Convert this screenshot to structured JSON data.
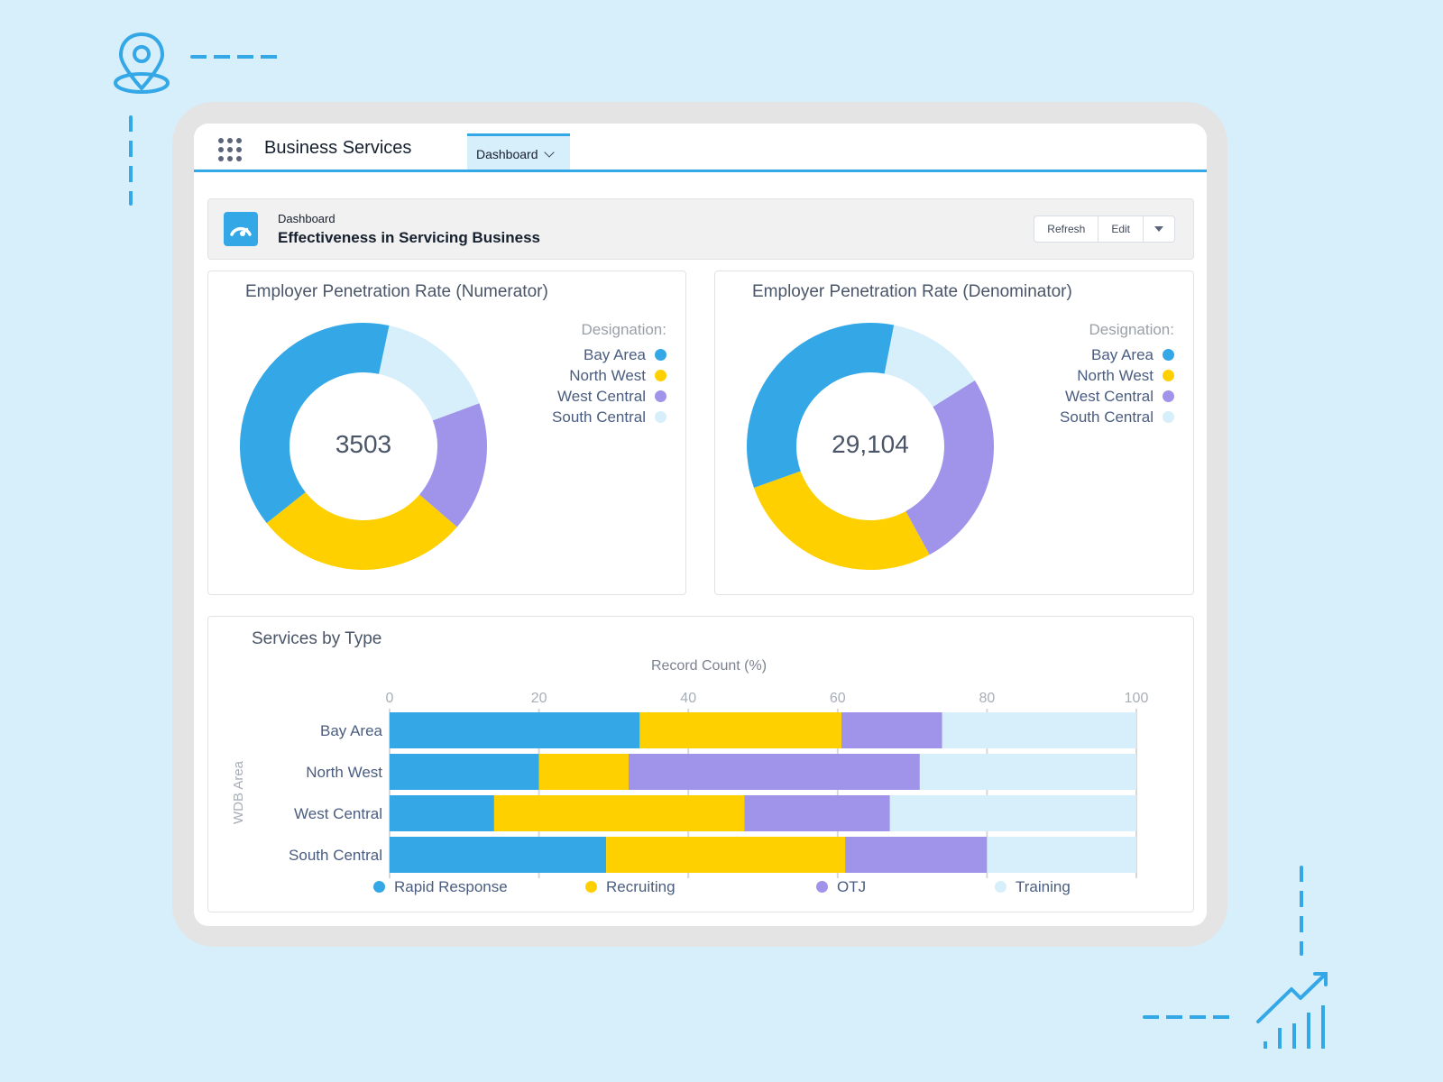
{
  "app": {
    "title": "Business Services",
    "nav_tab": "Dashboard"
  },
  "dashboard_header": {
    "label": "Dashboard",
    "title": "Effectiveness in Servicing Business",
    "buttons": {
      "refresh": "Refresh",
      "edit": "Edit"
    }
  },
  "colors": {
    "bay_area": "#34a8e6",
    "north_west": "#ffd000",
    "west_central": "#a094ea",
    "south_central": "#d7eefb",
    "accent": "#34a8e6"
  },
  "chart_data": [
    {
      "type": "pie",
      "variant": "donut",
      "title": "Employer Penetration Rate (Numerator)",
      "center_label": "3503",
      "legend_title": "Designation:",
      "legend_position": "top-right",
      "categories": [
        "Bay Area",
        "North West",
        "West Central",
        "South Central"
      ],
      "values": [
        39,
        28,
        17,
        16
      ]
    },
    {
      "type": "pie",
      "variant": "donut",
      "title": "Employer Penetration Rate (Denominator)",
      "center_label": "29,104",
      "legend_title": "Designation:",
      "legend_position": "top-right",
      "categories": [
        "Bay Area",
        "North West",
        "West Central",
        "South Central"
      ],
      "values": [
        33.5,
        27.5,
        26,
        13
      ]
    },
    {
      "type": "bar",
      "orientation": "horizontal",
      "stacked": true,
      "title": "Services by Type",
      "xlabel": "Record Count (%)",
      "ylabel": "WDB Area",
      "xlim": [
        0,
        100
      ],
      "xticks": [
        "0",
        "20",
        "40",
        "60",
        "80",
        "100"
      ],
      "grid": true,
      "legend_position": "bottom",
      "categories": [
        "Bay Area",
        "North West",
        "West Central",
        "South Central"
      ],
      "series": [
        {
          "name": "Rapid Response",
          "values": [
            33.5,
            20,
            14,
            29
          ]
        },
        {
          "name": "Recruiting",
          "values": [
            27,
            12,
            33.5,
            32
          ]
        },
        {
          "name": "OTJ",
          "values": [
            13.5,
            39,
            19.5,
            19
          ]
        },
        {
          "name": "Training",
          "values": [
            26,
            29,
            33,
            20
          ]
        }
      ]
    }
  ]
}
